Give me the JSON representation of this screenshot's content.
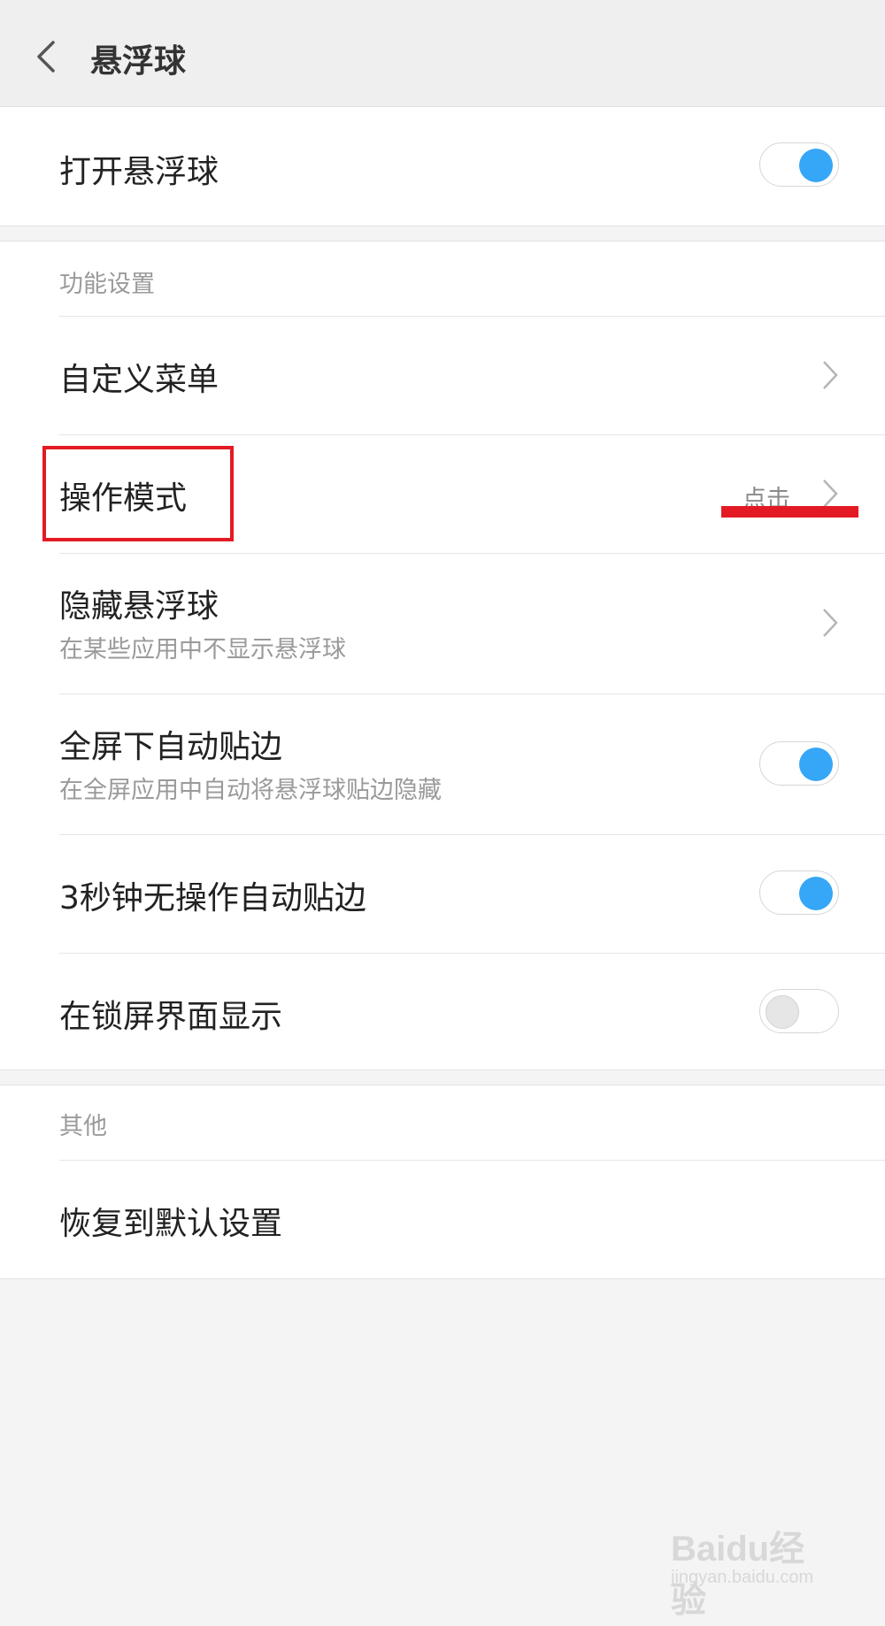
{
  "header": {
    "title": "悬浮球"
  },
  "main_card": {
    "toggle_label": "打开悬浮球",
    "toggle_on": true
  },
  "function_section": {
    "label": "功能设置",
    "rows": [
      {
        "title": "自定义菜单"
      },
      {
        "title": "操作模式",
        "value": "点击"
      },
      {
        "title": "隐藏悬浮球",
        "subtitle": "在某些应用中不显示悬浮球"
      },
      {
        "title": "全屏下自动贴边",
        "subtitle": "在全屏应用中自动将悬浮球贴边隐藏",
        "toggle_on": true
      },
      {
        "title": "3秒钟无操作自动贴边",
        "toggle_on": true
      },
      {
        "title": "在锁屏界面显示",
        "toggle_on": false
      }
    ]
  },
  "other_section": {
    "label": "其他",
    "rows": [
      {
        "title": "恢复到默认设置"
      }
    ]
  },
  "watermark": {
    "brand": "Baidu经验",
    "url": "jingyan.baidu.com"
  },
  "colors": {
    "accent": "#36a6f7",
    "highlight": "#e31a24"
  }
}
